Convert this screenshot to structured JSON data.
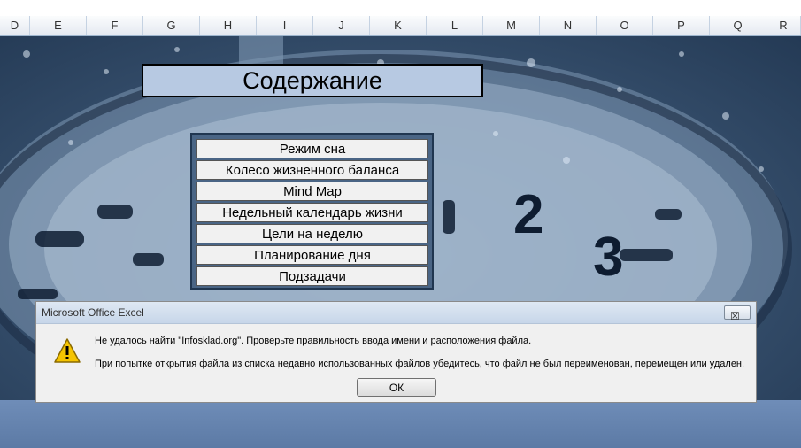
{
  "column_headers": [
    "D",
    "E",
    "F",
    "G",
    "H",
    "I",
    "J",
    "K",
    "L",
    "M",
    "N",
    "O",
    "P",
    "Q",
    "R"
  ],
  "contents": {
    "title": "Содержание",
    "items": [
      {
        "label": "Режим сна"
      },
      {
        "label": "Колесо жизненного баланса"
      },
      {
        "label": "Mind Map"
      },
      {
        "label": "Недельный календарь жизни"
      },
      {
        "label": "Цели на неделю"
      },
      {
        "label": "Планирование дня"
      },
      {
        "label": "Подзадачи"
      }
    ]
  },
  "background": {
    "clock_numerals": [
      "2",
      "3"
    ]
  },
  "dialog": {
    "title": "Microsoft Office Excel",
    "close_label": "☒",
    "icon": "warning-icon",
    "message1": "Не удалось найти \"Infosklad.org\". Проверьте правильность ввода имени и расположения файла.",
    "message2": "При попытке открытия файла из списка недавно использованных файлов убедитесь, что файл не был переименован, перемещен или удален.",
    "ok_label": "ОК"
  },
  "colors": {
    "title_fill": "#b7c9e2",
    "menu_frame": "#4a6585",
    "bottom_band": "#6f8db8",
    "warning_yellow": "#f5c400"
  }
}
